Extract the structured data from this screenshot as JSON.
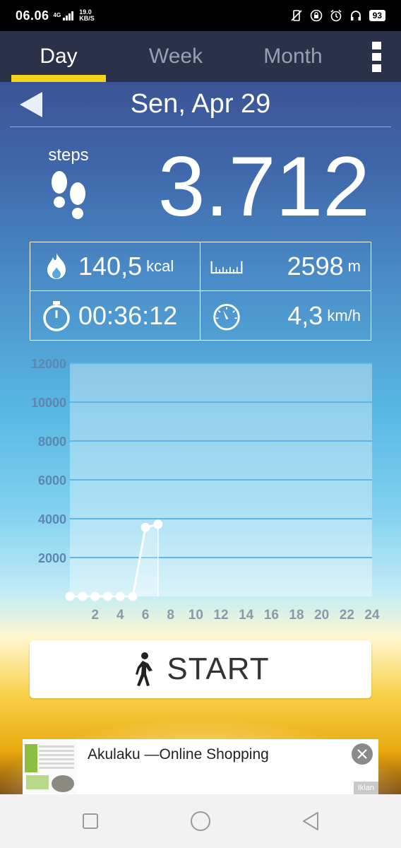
{
  "status_bar": {
    "time": "06.06",
    "network": "4G",
    "speed_value": "19.0",
    "speed_unit": "KB/S",
    "battery": "93"
  },
  "tabs": [
    {
      "label": "Day",
      "active": true
    },
    {
      "label": "Week",
      "active": false
    },
    {
      "label": "Month",
      "active": false
    }
  ],
  "date": "Sen, Apr 29",
  "steps": {
    "label": "steps",
    "count": "3.712"
  },
  "stats": {
    "calories": {
      "value": "140,5",
      "unit": "kcal"
    },
    "distance": {
      "value": "2598",
      "unit": "m"
    },
    "duration": {
      "value": "00:36:12"
    },
    "speed": {
      "value": "4,3",
      "unit": "km/h"
    }
  },
  "chart_data": {
    "type": "line",
    "x": [
      0,
      1,
      2,
      3,
      4,
      5,
      6,
      7
    ],
    "values": [
      0,
      0,
      0,
      0,
      0,
      0,
      3550,
      3712
    ],
    "xlim": [
      0,
      24
    ],
    "ylim": [
      0,
      12000
    ],
    "yticks": [
      2000,
      4000,
      6000,
      8000,
      10000,
      12000
    ],
    "xticks": [
      2,
      4,
      6,
      8,
      10,
      12,
      14,
      16,
      18,
      20,
      22,
      24
    ],
    "grid": true
  },
  "start_button": {
    "label": "START"
  },
  "ad": {
    "title": "Akulaku —Online Shopping",
    "badge": "Iklan"
  },
  "colors": {
    "tab_bg": "#2a3148",
    "accent": "#f5d21b",
    "chart_panel": "#e8f6fb"
  }
}
